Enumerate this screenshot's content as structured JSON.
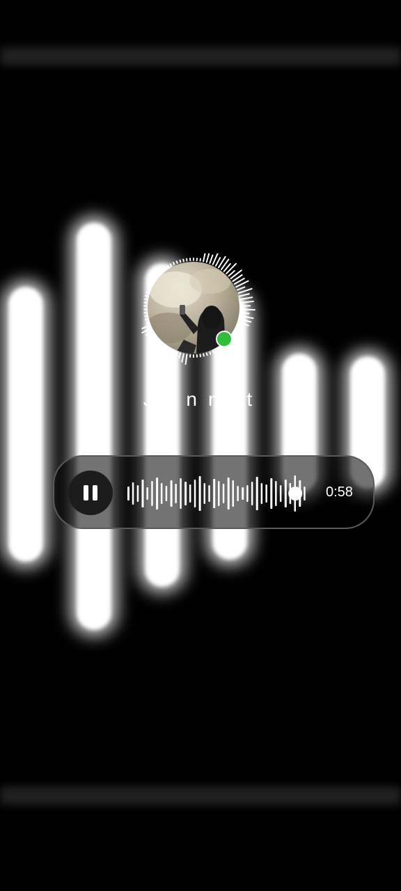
{
  "contact": {
    "name": "Jann  t",
    "online": true,
    "status_color": "#2fbf3a"
  },
  "player": {
    "state": "playing",
    "control_icon": "pause-icon",
    "time": "0:58",
    "progress": 0.97
  },
  "colors": {
    "background": "#000000",
    "accent": "#ffffff"
  }
}
